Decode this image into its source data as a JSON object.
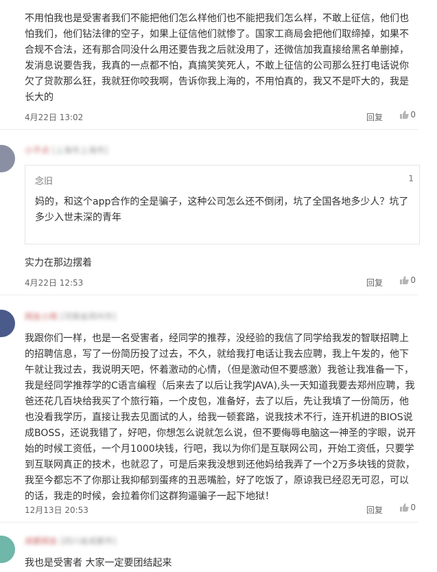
{
  "comments": [
    {
      "text": "不用怕我也是受害者我们不能把他们怎么样他们也不能把我们怎么样，不敢上征信，他们也怕我们，他们钻法律的空子，如果上征信他们就惨了。国家工商局会把他们取缔掉，如果不合规不合法，还有那合同没什么用还要告我之后就没用了，还微信加我直接给黑名单删掉，发消息说要告我，我真的一点都不怕，真搞笑笑死人，不敢上征信的公司那么狂打电话说你欠了贷款那么狂，我就狂你咬我啊，告诉你我上海的，不用怕真的，我又不是吓大的，我是长大的",
      "time": "4月22日 13:02",
      "reply": "回复",
      "likes": "0"
    },
    {
      "user": "小不点",
      "location": "[上海市上海市]",
      "quote": {
        "name": "念旧",
        "number": "1",
        "text": "妈的，和这个app合作的全是骗子，这种公司怎么还不倒闭，坑了全国各地多少人？坑了多少入世未深的青年"
      },
      "text": "实力在那边摆着",
      "time": "4月22日 12:53",
      "reply": "回复",
      "likes": "0"
    },
    {
      "user": "网友小雨",
      "location": "[河南省郑州市]",
      "text": "我跟你们一样，也是一名受害者，经同学的推荐，没经验的我信了同学给我发的智联招聘上的招聘信息，写了一份简历投了过去，不久，就给我打电话让我去应聘，我上午发的，他下午就让我过去，我说明天吧，怀着激动的心情，（但是激动但不要感激）我爸让我准备一下，我是经同学推荐学的C语言编程（后来去了以后让我学JAVA),头一天知道我要去郑州应聘，我爸还花几百块给我买了个旅行箱，一个皮包，准备好，去了以后，先让我填了一份简历，他也没看我学历，直接让我去见面试的人，给我一顿套路，说我技术不行，连开机进的BIOS说成BOSS，还说我错了，好吧，你想怎么说就怎么说，但不要侮辱电脑这一神圣的字眼，说开始的时候工资低，一个月1000块钱，行吧，我以为你们是互联网公司，开始工资低，只要学到互联网真正的技术，也就忍了，可是后来我没想到还他妈给我弄了一个2万多块钱的贷款，我至今都忘不了你那让我抑郁到蛋疼的丑恶嘴脸，好了吃饭了，原谅我已经忍无可忍，可以的话，我走的时候，会拉着你们这群狗逼骗子一起下地狱！",
      "time": "12月13日 20:53",
      "reply": "回复",
      "likes": "0"
    },
    {
      "user": "成都网友",
      "location": "[四川省成都市]",
      "text": "我也是受害者 大家一定要团结起来"
    }
  ],
  "colors": {
    "text": "#333333",
    "meta": "#666666",
    "divider": "#eeeeee",
    "avatar2": "#8a8fa3",
    "avatar3": "#4a5a8a",
    "avatar4": "#6fb7a8"
  },
  "icons": {
    "like": "thumb-up-icon"
  }
}
